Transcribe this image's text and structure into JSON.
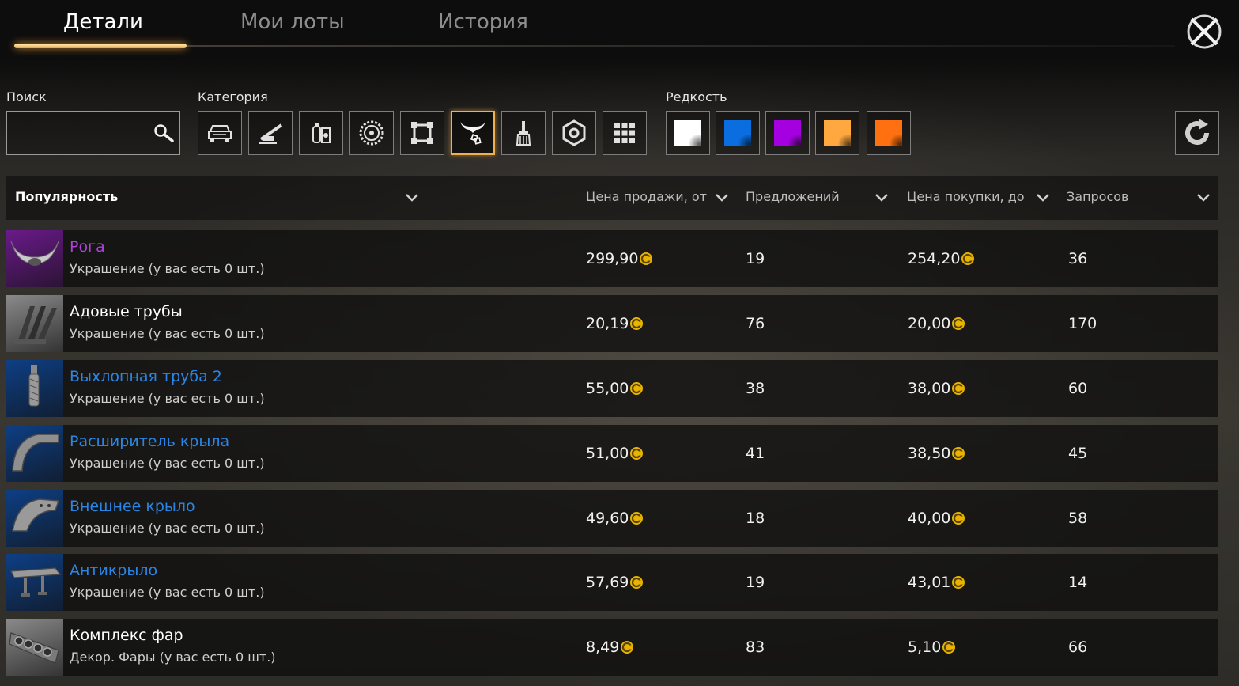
{
  "tabs": [
    {
      "label": "Детали",
      "active": true
    },
    {
      "label": "Мои лоты",
      "active": false
    },
    {
      "label": "История",
      "active": false
    }
  ],
  "filters": {
    "search_label": "Поиск",
    "search_value": "",
    "category_label": "Категория",
    "categories": [
      "car-icon",
      "cannon-icon",
      "gadget-icon",
      "wheel-icon",
      "frame-icon",
      "horns-decor-icon",
      "paint-brush-icon",
      "nut-icon",
      "grid-icon"
    ],
    "active_category": "horns-decor-icon",
    "rarity_label": "Редкость",
    "rarities": [
      {
        "name": "common",
        "color": "#ffffff"
      },
      {
        "name": "rare",
        "color": "#0a6de0"
      },
      {
        "name": "epic",
        "color": "#a400e0"
      },
      {
        "name": "legendary",
        "color": "#ffa840"
      },
      {
        "name": "relic",
        "color": "#ff7010"
      }
    ]
  },
  "table": {
    "columns": [
      {
        "label": "Популярность"
      },
      {
        "label": "Цена продажи, от"
      },
      {
        "label": "Предложений"
      },
      {
        "label": "Цена покупки, до"
      },
      {
        "label": "Запросов"
      }
    ],
    "rows": [
      {
        "name": "Рога",
        "subtitle": "Украшение (у вас есть 0 шт.)",
        "rarity_color": "#b13ee0",
        "thumb_bg": "#6a1a8a",
        "thumb_icon": "horns-icon",
        "sell": "299,90",
        "offers": "19",
        "buy": "254,20",
        "requests": "36"
      },
      {
        "name": "Адовые трубы",
        "subtitle": "Украшение (у вас есть 0 шт.)",
        "rarity_color": "#ffffff",
        "thumb_bg": "#8a8a8a",
        "thumb_icon": "exhaust-pipes-icon",
        "sell": "20,19",
        "offers": "76",
        "buy": "20,00",
        "requests": "170"
      },
      {
        "name": "Выхлопная труба 2",
        "subtitle": "Украшение (у вас есть 0 шт.)",
        "rarity_color": "#2a86e6",
        "thumb_bg": "#0e3f85",
        "thumb_icon": "exhaust-pipe-icon",
        "sell": "55,00",
        "offers": "38",
        "buy": "38,00",
        "requests": "60"
      },
      {
        "name": "Расширитель крыла",
        "subtitle": "Украшение (у вас есть 0 шт.)",
        "rarity_color": "#2a86e6",
        "thumb_bg": "#0e3f85",
        "thumb_icon": "fender-flare-icon",
        "sell": "51,00",
        "offers": "41",
        "buy": "38,50",
        "requests": "45"
      },
      {
        "name": "Внешнее крыло",
        "subtitle": "Украшение (у вас есть 0 шт.)",
        "rarity_color": "#2a86e6",
        "thumb_bg": "#0e3f85",
        "thumb_icon": "outer-fender-icon",
        "sell": "49,60",
        "offers": "18",
        "buy": "40,00",
        "requests": "58"
      },
      {
        "name": "Антикрыло",
        "subtitle": "Украшение (у вас есть 0 шт.)",
        "rarity_color": "#2a86e6",
        "thumb_bg": "#0e3f85",
        "thumb_icon": "spoiler-icon",
        "sell": "57,69",
        "offers": "19",
        "buy": "43,01",
        "requests": "14"
      },
      {
        "name": "Комплекс фар",
        "subtitle": "Декор. Фары (у вас есть 0 шт.)",
        "rarity_color": "#ffffff",
        "thumb_bg": "#8a8a8a",
        "thumb_icon": "headlights-icon",
        "sell": "8,49",
        "offers": "83",
        "buy": "5,10",
        "requests": "66"
      }
    ]
  },
  "colors": {
    "accent": "#f0b050",
    "coin": "#e9b400"
  }
}
